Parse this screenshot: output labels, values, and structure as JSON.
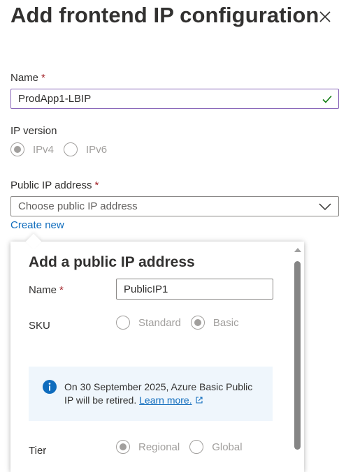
{
  "panel": {
    "title": "Add frontend IP configuration",
    "close_icon": "close-icon"
  },
  "name_field": {
    "label": "Name",
    "required_mark": "*",
    "value": "ProdApp1-LBIP",
    "status_icon": "checkmark-icon",
    "valid_color": "#8764b8"
  },
  "ip_version": {
    "label": "IP version",
    "options": [
      {
        "label": "IPv4",
        "selected": true
      },
      {
        "label": "IPv6",
        "selected": false
      }
    ]
  },
  "public_ip": {
    "label": "Public IP address",
    "required_mark": "*",
    "placeholder": "Choose public IP address",
    "create_new_link": "Create new"
  },
  "callout": {
    "title": "Add a public IP address",
    "name_label": "Name",
    "name_required_mark": "*",
    "name_value": "PublicIP1",
    "sku_label": "SKU",
    "sku_options": [
      {
        "label": "Standard",
        "selected": false
      },
      {
        "label": "Basic",
        "selected": true
      }
    ],
    "info": {
      "icon": "info-icon",
      "text": "On 30 September 2025, Azure Basic Public IP will be retired.",
      "link_text": "Learn more.",
      "link_icon": "external-link-icon"
    },
    "tier_label": "Tier",
    "tier_options": [
      {
        "label": "Regional",
        "selected": true
      },
      {
        "label": "Global",
        "selected": false
      }
    ]
  },
  "colors": {
    "accent_link": "#0f6cbd",
    "required": "#a4262c",
    "info_bg": "#eff6fc",
    "disabled_text": "#a19f9d"
  }
}
